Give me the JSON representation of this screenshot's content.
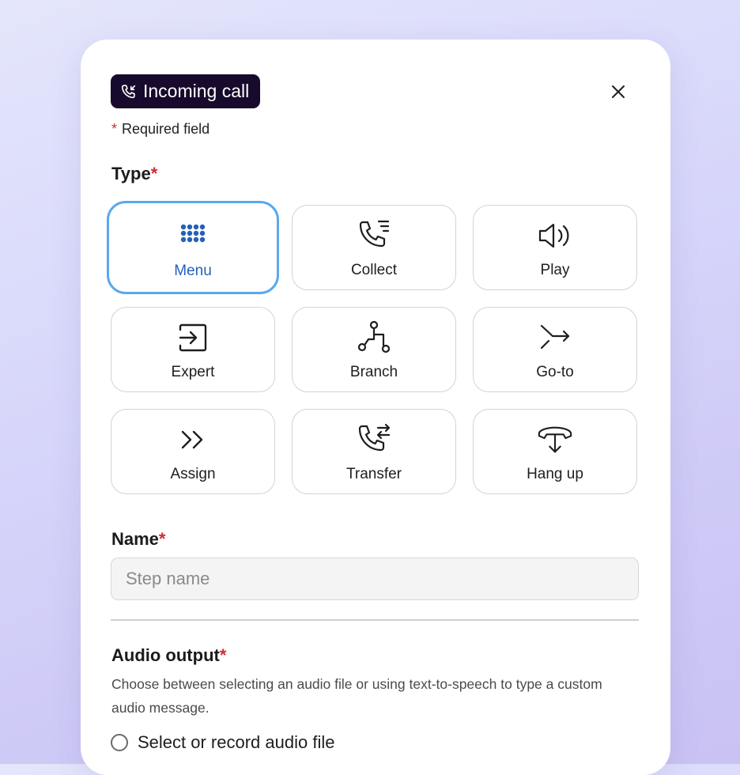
{
  "header": {
    "tag_label": "Incoming call",
    "close_label": "×"
  },
  "form": {
    "required_note": "Required field",
    "required_marker": "*",
    "type_label": "Type",
    "name_label": "Name",
    "name_placeholder": "Step name",
    "audio_label": "Audio output",
    "audio_description": "Choose between selecting an audio file or using text-to-speech to type a custom audio message.",
    "audio_option_1": "Select or record audio file"
  },
  "types": [
    {
      "label": "Menu",
      "icon": "dialpad-icon",
      "selected": true
    },
    {
      "label": "Collect",
      "icon": "phone-list-icon",
      "selected": false
    },
    {
      "label": "Play",
      "icon": "speaker-icon",
      "selected": false
    },
    {
      "label": "Expert",
      "icon": "enter-box-icon",
      "selected": false
    },
    {
      "label": "Branch",
      "icon": "branch-icon",
      "selected": false
    },
    {
      "label": "Go-to",
      "icon": "goto-arrow-icon",
      "selected": false
    },
    {
      "label": "Assign",
      "icon": "double-chevron-icon",
      "selected": false
    },
    {
      "label": "Transfer",
      "icon": "phone-transfer-icon",
      "selected": false
    },
    {
      "label": "Hang up",
      "icon": "hang-up-icon",
      "selected": false
    }
  ],
  "colors": {
    "selected_border": "#5aa8ee",
    "selected_text": "#2461b8",
    "required_star": "#d22a3a",
    "tag_background": "#170a2c"
  }
}
